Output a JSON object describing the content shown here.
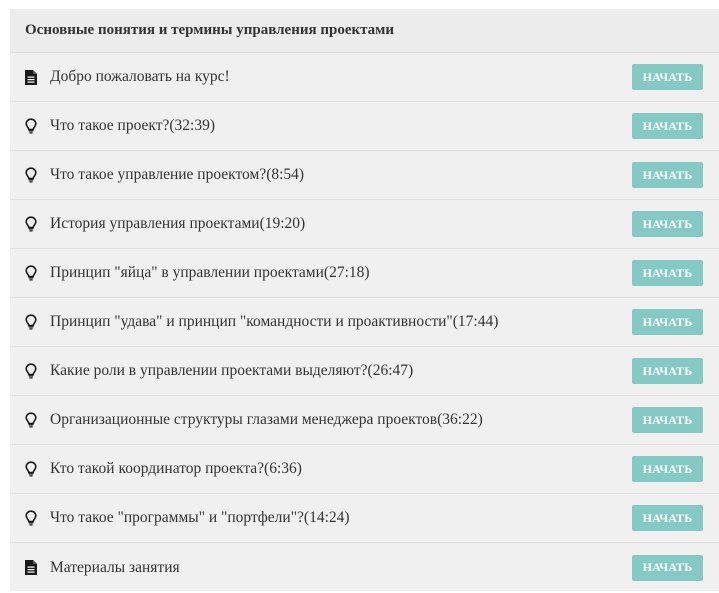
{
  "panel": {
    "title": "Основные понятия и термины управления проектами"
  },
  "lessons": [
    {
      "icon": "document-icon",
      "title": "Добро пожаловать на курс!",
      "button": "НАЧАТЬ"
    },
    {
      "icon": "lightbulb-icon",
      "title": "Что такое проект?(32:39)",
      "button": "НАЧАТЬ"
    },
    {
      "icon": "lightbulb-icon",
      "title": "Что такое управление проектом?(8:54)",
      "button": "НАЧАТЬ"
    },
    {
      "icon": "lightbulb-icon",
      "title": "История управления проектами(19:20)",
      "button": "НАЧАТЬ"
    },
    {
      "icon": "lightbulb-icon",
      "title": "Принцип \"яйца\" в управлении проектами(27:18)",
      "button": "НАЧАТЬ"
    },
    {
      "icon": "lightbulb-icon",
      "title": "Принцип \"удава\" и принцип \"командности и проактивности\"(17:44)",
      "button": "НАЧАТЬ"
    },
    {
      "icon": "lightbulb-icon",
      "title": "Какие роли в управлении проектами выделяют?(26:47)",
      "button": "НАЧАТЬ"
    },
    {
      "icon": "lightbulb-icon",
      "title": "Организационные структуры глазами менеджера проектов(36:22)",
      "button": "НАЧАТЬ"
    },
    {
      "icon": "lightbulb-icon",
      "title": "Кто такой координатор проекта?(6:36)",
      "button": "НАЧАТЬ"
    },
    {
      "icon": "lightbulb-icon",
      "title": "Что такое \"программы\" и \"портфели\"?(14:24)",
      "button": "НАЧАТЬ"
    },
    {
      "icon": "document-icon",
      "title": "Материалы занятия",
      "button": "НАЧАТЬ"
    }
  ],
  "colors": {
    "button_bg": "#84c9c4",
    "button_text": "#ffffff",
    "panel_bg": "#f0f0f0"
  }
}
